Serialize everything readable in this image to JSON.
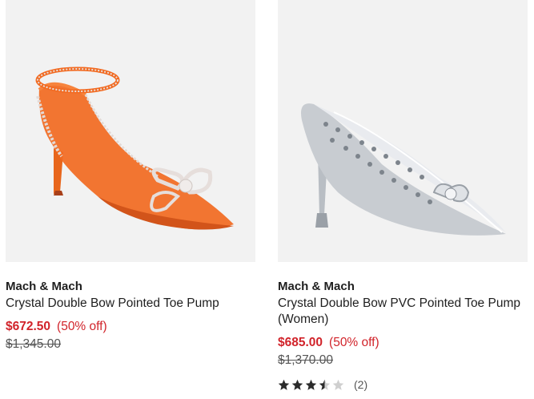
{
  "products": [
    {
      "image": "orange-crystal-bow-pump",
      "brand": "Mach & Mach",
      "title": "Crystal Double Bow Pointed Toe Pump",
      "price": "$672.50",
      "discount": "(50% off)",
      "original_price": "$1,345.00"
    },
    {
      "image": "clear-crystal-bow-pvc-pump",
      "brand": "Mach & Mach",
      "title": "Crystal Double Bow PVC Pointed Toe Pump (Women)",
      "price": "$685.00",
      "discount": "(50% off)",
      "original_price": "$1,370.00",
      "rating": 3.5,
      "review_count": "(2)"
    }
  ],
  "colors": {
    "sale": "#d1232a",
    "image_bg": "#f2f2f2"
  }
}
